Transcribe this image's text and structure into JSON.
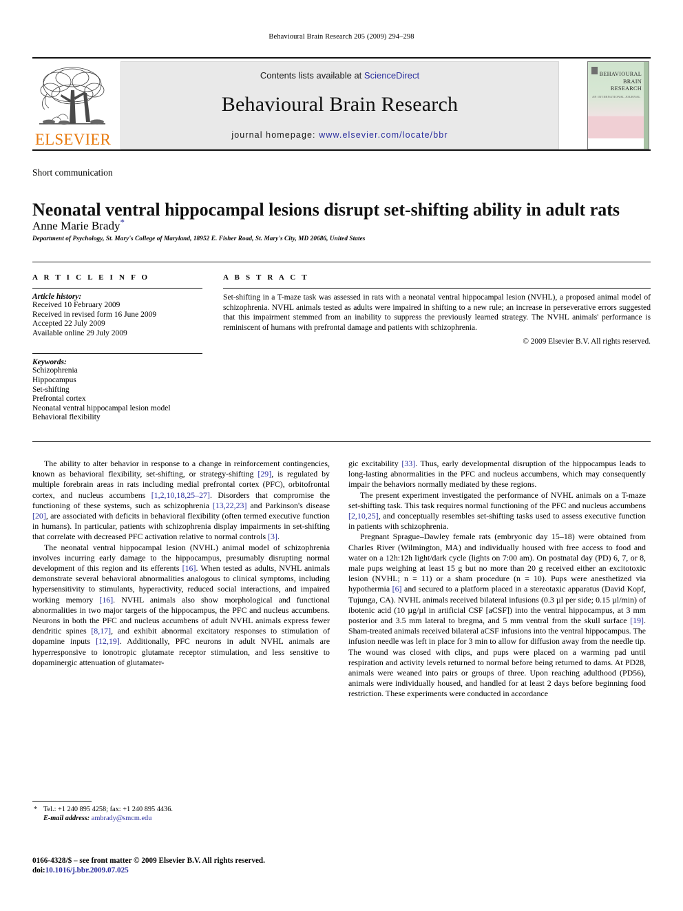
{
  "running_head": "Behavioural Brain Research 205 (2009) 294–298",
  "masthead": {
    "publisher_name": "ELSEVIER",
    "contents_prefix": "Contents lists available at ",
    "contents_link": "ScienceDirect",
    "journal_title": "Behavioural Brain Research",
    "homepage_prefix": "journal homepage: ",
    "homepage_url": "www.elsevier.com/locate/bbr",
    "cover": {
      "title_line1": "BEHAVIOURAL",
      "title_line2": "BRAIN",
      "title_line3": "RESEARCH",
      "subtitle": "AN INTERNATIONAL JOURNAL"
    }
  },
  "article": {
    "section_type": "Short communication",
    "title": "Neonatal ventral hippocampal lesions disrupt set-shifting ability in adult rats",
    "author": "Anne Marie Brady",
    "author_footnote_marker": "*",
    "affiliation": "Department of Psychology, St. Mary's College of Maryland, 18952 E. Fisher Road, St. Mary's City, MD 20686, United States"
  },
  "article_info": {
    "heading": "A R T I C L E    I N F O",
    "history_label": "Article history:",
    "history": [
      "Received 10 February 2009",
      "Received in revised form 16 June 2009",
      "Accepted 22 July 2009",
      "Available online 29 July 2009"
    ],
    "keywords_label": "Keywords:",
    "keywords": [
      "Schizophrenia",
      "Hippocampus",
      "Set-shifting",
      "Prefrontal cortex",
      "Neonatal ventral hippocampal lesion model",
      "Behavioral flexibility"
    ]
  },
  "abstract": {
    "heading": "A B S T R A C T",
    "text": "Set-shifting in a T-maze task was assessed in rats with a neonatal ventral hippocampal lesion (NVHL), a proposed animal model of schizophrenia. NVHL animals tested as adults were impaired in shifting to a new rule; an increase in perseverative errors suggested that this impairment stemmed from an inability to suppress the previously learned strategy. The NVHL animals' performance is reminiscent of humans with prefrontal damage and patients with schizophrenia.",
    "copyright": "© 2009 Elsevier B.V. All rights reserved."
  },
  "body": {
    "left": [
      "The ability to alter behavior in response to a change in reinforcement contingencies, known as behavioral flexibility, set-shifting, or strategy-shifting [29], is regulated by multiple forebrain areas in rats including medial prefrontal cortex (PFC), orbitofrontal cortex, and nucleus accumbens [1,2,10,18,25–27]. Disorders that compromise the functioning of these systems, such as schizophrenia [13,22,23] and Parkinson's disease [20], are associated with deficits in behavioral flexibility (often termed executive function in humans). In particular, patients with schizophrenia display impairments in set-shifting that correlate with decreased PFC activation relative to normal controls [3].",
      "The neonatal ventral hippocampal lesion (NVHL) animal model of schizophrenia involves incurring early damage to the hippocampus, presumably disrupting normal development of this region and its efferents [16]. When tested as adults, NVHL animals demonstrate several behavioral abnormalities analogous to clinical symptoms, including hypersensitivity to stimulants, hyperactivity, reduced social interactions, and impaired working memory [16]. NVHL animals also show morphological and functional abnormalities in two major targets of the hippocampus, the PFC and nucleus accumbens. Neurons in both the PFC and nucleus accumbens of adult NVHL animals express fewer dendritic spines [8,17], and exhibit abnormal excitatory responses to stimulation of dopamine inputs [12,19]. Additionally, PFC neurons in adult NVHL animals are hyperresponsive to ionotropic glutamate receptor stimulation, and less sensitive to dopaminergic attenuation of glutamater-"
    ],
    "right": [
      "gic excitability [33]. Thus, early developmental disruption of the hippocampus leads to long-lasting abnormalities in the PFC and nucleus accumbens, which may consequently impair the behaviors normally mediated by these regions.",
      "The present experiment investigated the performance of NVHL animals on a T-maze set-shifting task. This task requires normal functioning of the PFC and nucleus accumbens [2,10,25], and conceptually resembles set-shifting tasks used to assess executive function in patients with schizophrenia.",
      "Pregnant Sprague–Dawley female rats (embryonic day 15–18) were obtained from Charles River (Wilmington, MA) and individually housed with free access to food and water on a 12h:12h light/dark cycle (lights on 7:00 am). On postnatal day (PD) 6, 7, or 8, male pups weighing at least 15 g but no more than 20 g received either an excitotoxic lesion (NVHL; n = 11) or a sham procedure (n = 10). Pups were anesthetized via hypothermia [6] and secured to a platform placed in a stereotaxic apparatus (David Kopf, Tujunga, CA). NVHL animals received bilateral infusions (0.3 µl per side; 0.15 µl/min) of ibotenic acid (10 µg/µl in artificial CSF [aCSF]) into the ventral hippocampus, at 3 mm posterior and 3.5 mm lateral to bregma, and 5 mm ventral from the skull surface [19]. Sham-treated animals received bilateral aCSF infusions into the ventral hippocampus. The infusion needle was left in place for 3 min to allow for diffusion away from the needle tip. The wound was closed with clips, and pups were placed on a warming pad until respiration and activity levels returned to normal before being returned to dams. At PD28, animals were weaned into pairs or groups of three. Upon reaching adulthood (PD56), animals were individually housed, and handled for at least 2 days before beginning food restriction. These experiments were conducted in accordance"
    ]
  },
  "footnote": {
    "marker": "*",
    "contact": "Tel.: +1 240 895 4258; fax: +1 240 895 4436.",
    "email_label": "E-mail address:",
    "email": "ambrady@smcm.edu"
  },
  "imprint": {
    "issn_line": "0166-4328/$ – see front matter © 2009 Elsevier B.V. All rights reserved.",
    "doi_label": "doi:",
    "doi": "10.1016/j.bbr.2009.07.025"
  }
}
